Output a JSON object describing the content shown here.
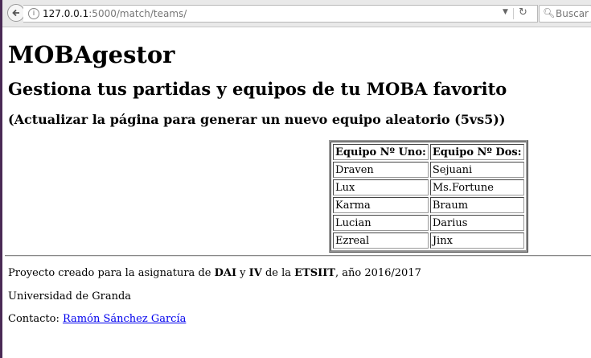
{
  "browser": {
    "url_host": "127.0.0.1",
    "url_rest": ":5000/match/teams/",
    "search_placeholder": "Buscar"
  },
  "page": {
    "title": "MOBAgestor",
    "subtitle": "Gestiona tus partidas y equipos de tu MOBA favorito",
    "instruction": "(Actualizar la página para generar un nuevo equipo aleatorio (5vs5))",
    "table": {
      "headers": [
        "Equipo Nº Uno:",
        "Equipo Nº Dos:"
      ],
      "rows": [
        [
          "Draven",
          "Sejuani"
        ],
        [
          "Lux",
          "Ms.Fortune"
        ],
        [
          "Karma",
          "Braum"
        ],
        [
          "Lucian",
          "Darius"
        ],
        [
          "Ezreal",
          "Jinx"
        ]
      ]
    },
    "footer": {
      "line1_prefix": "Proyecto creado para la asignatura de ",
      "dai": "DAI",
      "and": " y ",
      "iv": "IV",
      "of": " de la ",
      "etsiit": "ETSIIT",
      "line1_suffix": ", año 2016/2017",
      "university": "Universidad de Granda",
      "contact_label": "Contacto: ",
      "contact_name": "Ramón Sánchez García"
    }
  }
}
